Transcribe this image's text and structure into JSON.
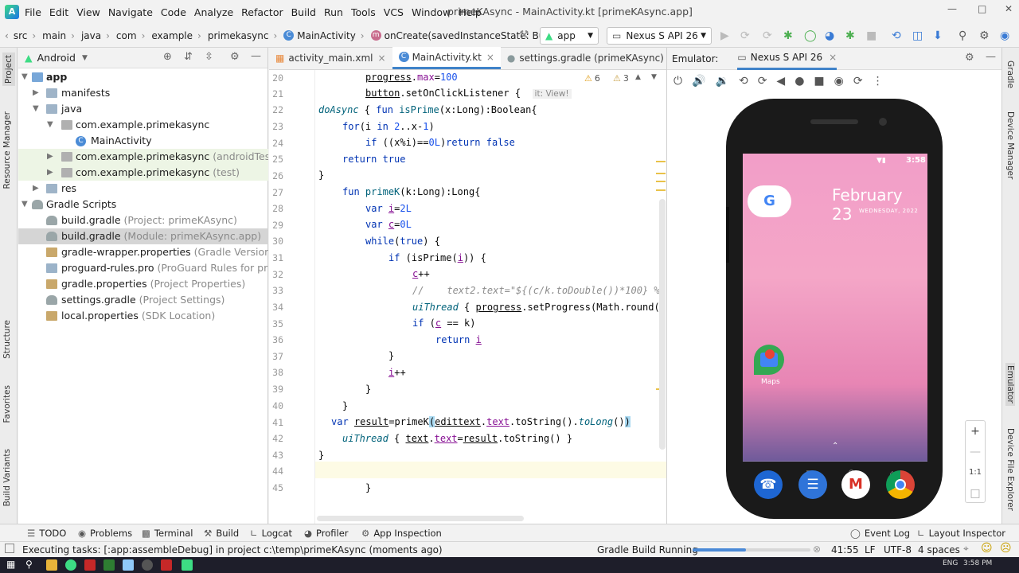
{
  "menu": {
    "items": [
      "File",
      "Edit",
      "View",
      "Navigate",
      "Code",
      "Analyze",
      "Refactor",
      "Build",
      "Run",
      "Tools",
      "VCS",
      "Window",
      "Help"
    ],
    "window_title": "primeKAsync - MainActivity.kt [primeKAsync.app]"
  },
  "breadcrumb": {
    "items": [
      "src",
      "main",
      "java",
      "com",
      "example",
      "primekasync"
    ],
    "class_name": "MainActivity",
    "method": "onCreate(savedInstanceState: Bundle?)"
  },
  "toolbar": {
    "run_config": "app",
    "device": "Nexus S API 26"
  },
  "left_strip": {
    "project": "Project",
    "resource_manager": "Resource Manager",
    "structure": "Structure",
    "favorites": "Favorites",
    "build_variants": "Build Variants"
  },
  "right_strip": {
    "gradle": "Gradle",
    "device_manager": "Device Manager",
    "emulator": "Emulator",
    "device_file_explorer": "Device File Explorer"
  },
  "project_panel": {
    "view": "Android",
    "tree": [
      {
        "label": "app",
        "hint": ""
      },
      {
        "label": "manifests",
        "hint": ""
      },
      {
        "label": "java",
        "hint": ""
      },
      {
        "label": "com.example.primekasync",
        "hint": ""
      },
      {
        "label": "MainActivity",
        "hint": ""
      },
      {
        "label": "com.example.primekasync",
        "hint": "(androidTest)"
      },
      {
        "label": "com.example.primekasync",
        "hint": "(test)"
      },
      {
        "label": "res",
        "hint": ""
      },
      {
        "label": "Gradle Scripts",
        "hint": ""
      },
      {
        "label": "build.gradle",
        "hint": "(Project: primeKAsync)"
      },
      {
        "label": "build.gradle",
        "hint": "(Module: primeKAsync.app)"
      },
      {
        "label": "gradle-wrapper.properties",
        "hint": "(Gradle Version)"
      },
      {
        "label": "proguard-rules.pro",
        "hint": "(ProGuard Rules for primeKAs"
      },
      {
        "label": "gradle.properties",
        "hint": "(Project Properties)"
      },
      {
        "label": "settings.gradle",
        "hint": "(Project Settings)"
      },
      {
        "label": "local.properties",
        "hint": "(SDK Location)"
      }
    ]
  },
  "editor": {
    "tabs": [
      "activity_main.xml",
      "MainActivity.kt",
      "settings.gradle (primeKAsync)"
    ],
    "warnings": "6",
    "weak_warnings": "3",
    "inlay_hint": "it: View!",
    "line_numbers": [
      "20",
      "21",
      "22",
      "23",
      "24",
      "25",
      "26",
      "27",
      "28",
      "29",
      "30",
      "31",
      "32",
      "33",
      "34",
      "35",
      "36",
      "37",
      "38",
      "39",
      "40",
      "41",
      "42",
      "43",
      "44",
      "45"
    ]
  },
  "emulator": {
    "label": "Emulator:",
    "device_tab": "Nexus S API 26",
    "status_time": "3:58",
    "date": "February 23",
    "weekday": "WEDNESDAY, 2022",
    "maps_label": "Maps",
    "zoom_ratio": "1:1"
  },
  "bottom_tools": {
    "todo": "TODO",
    "problems": "Problems",
    "terminal": "Terminal",
    "build": "Build",
    "logcat": "Logcat",
    "profiler": "Profiler",
    "app_inspection": "App Inspection",
    "event_log": "Event Log",
    "layout_inspector": "Layout Inspector"
  },
  "status": {
    "message": "Executing tasks: [:app:assembleDebug] in project c:\\temp\\primeKAsync (moments ago)",
    "task": "Gradle Build Running",
    "position": "41:55",
    "line_sep": "LF",
    "encoding": "UTF-8",
    "indent": "4 spaces"
  },
  "taskbar": {
    "lang": "ENG",
    "time": "3:58 PM"
  }
}
